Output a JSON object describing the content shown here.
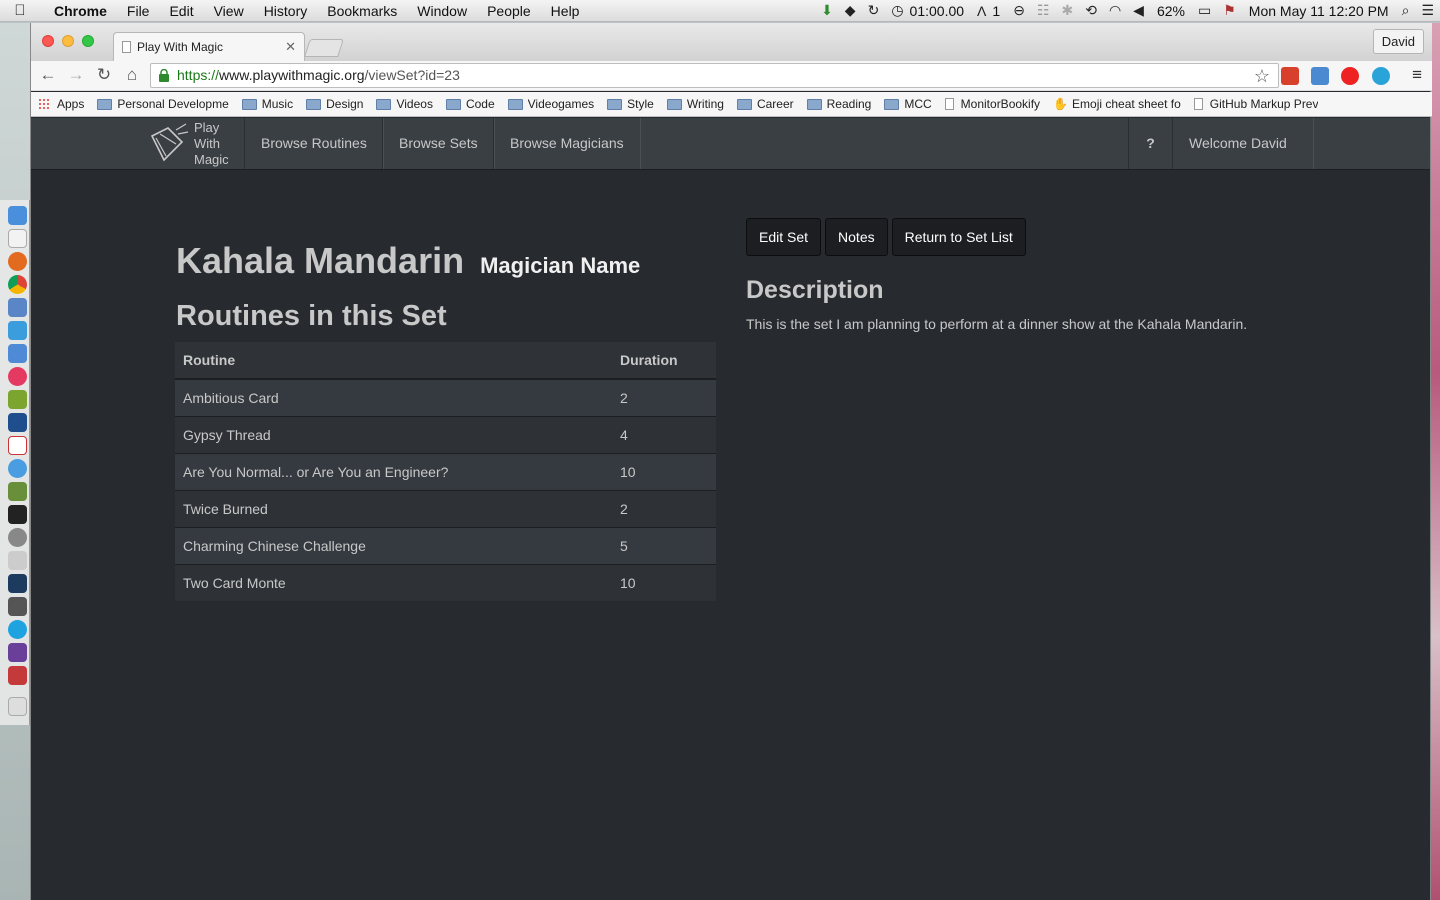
{
  "menubar": {
    "app": "Chrome",
    "items": [
      "File",
      "Edit",
      "View",
      "History",
      "Bookmarks",
      "Window",
      "People",
      "Help"
    ],
    "timer": "01:00.00",
    "adobe_count": "1",
    "battery": "62%",
    "datetime": "Mon May 11  12:20 PM"
  },
  "browser": {
    "tab_title": "Play With Magic",
    "profile": "David",
    "url_scheme": "https://",
    "url_host": "www.playwithmagic.org",
    "url_path": "/viewSet?id=23",
    "bookmarks": [
      {
        "label": "Apps",
        "icon": "apps-icon"
      },
      {
        "label": "Personal Developme",
        "icon": "folder-icon"
      },
      {
        "label": "Music",
        "icon": "folder-icon"
      },
      {
        "label": "Design",
        "icon": "folder-icon"
      },
      {
        "label": "Videos",
        "icon": "folder-icon"
      },
      {
        "label": "Code",
        "icon": "folder-icon"
      },
      {
        "label": "Videogames",
        "icon": "folder-icon"
      },
      {
        "label": "Style",
        "icon": "folder-icon"
      },
      {
        "label": "Writing",
        "icon": "folder-icon"
      },
      {
        "label": "Career",
        "icon": "folder-icon"
      },
      {
        "label": "Reading",
        "icon": "folder-icon"
      },
      {
        "label": "MCC",
        "icon": "folder-icon"
      },
      {
        "label": "MonitorBookify",
        "icon": "page-icon"
      },
      {
        "label": "Emoji cheat sheet fo",
        "icon": "thumb-icon"
      },
      {
        "label": "GitHub Markup Prev",
        "icon": "page-icon"
      }
    ]
  },
  "site": {
    "brand": [
      "Play",
      "With",
      "Magic"
    ],
    "nav": [
      "Browse Routines",
      "Browse Sets",
      "Browse Magicians"
    ],
    "help": "?",
    "welcome": "Welcome David"
  },
  "set": {
    "name": "Kahala Mandarin",
    "magician": "Magician Name",
    "routines_heading": "Routines in this Set",
    "columns": [
      "Routine",
      "Duration"
    ],
    "routines": [
      {
        "name": "Ambitious Card",
        "duration": "2"
      },
      {
        "name": "Gypsy Thread",
        "duration": "4"
      },
      {
        "name": "Are You Normal... or Are You an Engineer?",
        "duration": "10"
      },
      {
        "name": "Twice Burned",
        "duration": "2"
      },
      {
        "name": "Charming Chinese Challenge",
        "duration": "5"
      },
      {
        "name": "Two Card Monte",
        "duration": "10"
      }
    ],
    "buttons": [
      "Edit Set",
      "Notes",
      "Return to Set List"
    ],
    "description_heading": "Description",
    "description": "This is the set I am planning to perform at a dinner show at the Kahala Mandarin."
  },
  "colors": {
    "page_bg": "#272b30",
    "navbar_bg": "#3a3f44",
    "button_bg": "#1c1e22",
    "text": "#c8c8c8"
  }
}
